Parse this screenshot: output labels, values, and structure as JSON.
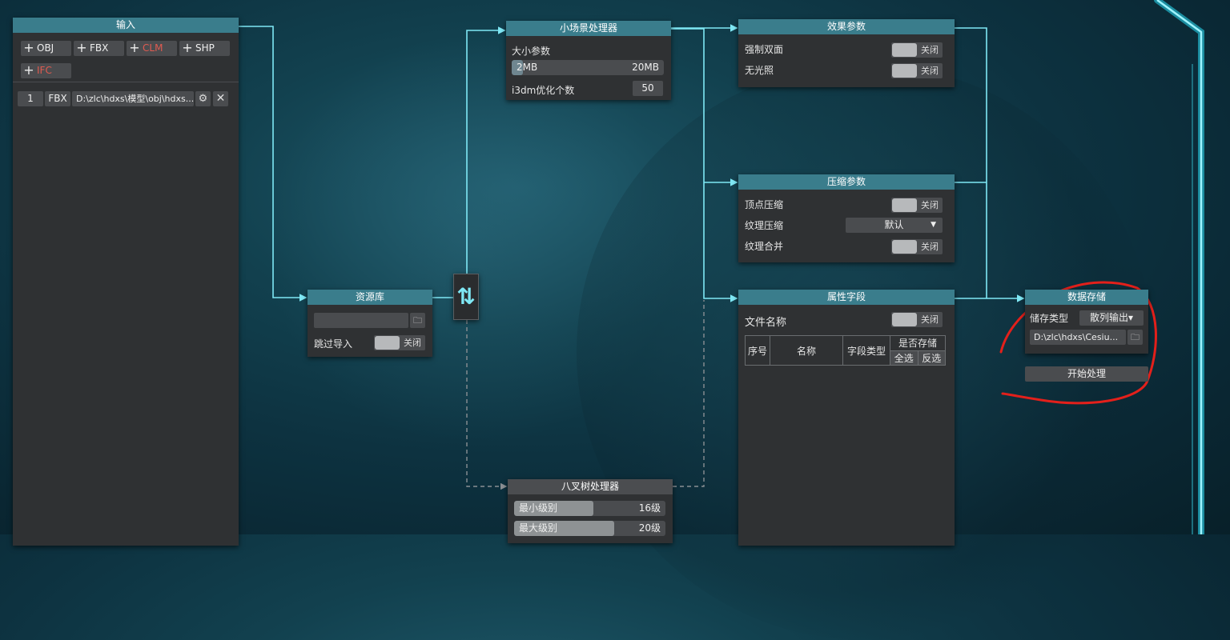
{
  "input_panel": {
    "title": "输入",
    "add_buttons": [
      "OBJ",
      "FBX",
      "CLM",
      "SHP",
      "IFC"
    ],
    "file_row": {
      "index": "1",
      "type": "FBX",
      "path": "D:\\zlc\\hdxs\\模型\\obj\\hdxs..."
    }
  },
  "resource_panel": {
    "title": "资源库",
    "path_value": "",
    "skip_label": "跳过导入",
    "toggle_label": "关闭"
  },
  "switch_node": {
    "symbol": "⇅"
  },
  "small_scene_panel": {
    "title": "小场景处理器",
    "size_label": "大小参数",
    "size_min": "2MB",
    "size_max": "20MB",
    "i3dm_label": "i3dm优化个数",
    "i3dm_value": "50"
  },
  "effect_panel": {
    "title": "效果参数",
    "double_side_label": "强制双面",
    "no_light_label": "无光照",
    "toggle_label": "关闭"
  },
  "compress_panel": {
    "title": "压缩参数",
    "vertex_label": "顶点压缩",
    "texture_label": "纹理压缩",
    "texture_value": "默认",
    "merge_label": "纹理合并",
    "toggle_label": "关闭"
  },
  "attribute_panel": {
    "title": "属性字段",
    "filename_label": "文件名称",
    "toggle_label": "关闭",
    "columns": [
      "序号",
      "名称",
      "字段类型",
      "是否存储"
    ],
    "select_all": "全选",
    "invert": "反选"
  },
  "storage_panel": {
    "title": "数据存储",
    "type_label": "储存类型",
    "type_value": "散列输出▾",
    "path_value": "D:\\zlc\\hdxs\\Cesiu...",
    "start_button": "开始处理"
  },
  "octree_panel": {
    "title": "八叉树处理器",
    "min_level_label": "最小级别",
    "min_level_value": "16级",
    "max_level_label": "最大级别",
    "max_level_value": "20级"
  },
  "colors": {
    "accent": "#3a7d8c",
    "connector": "#7fe8f5",
    "annotation": "#e3201b",
    "panel": "#2f3133"
  }
}
